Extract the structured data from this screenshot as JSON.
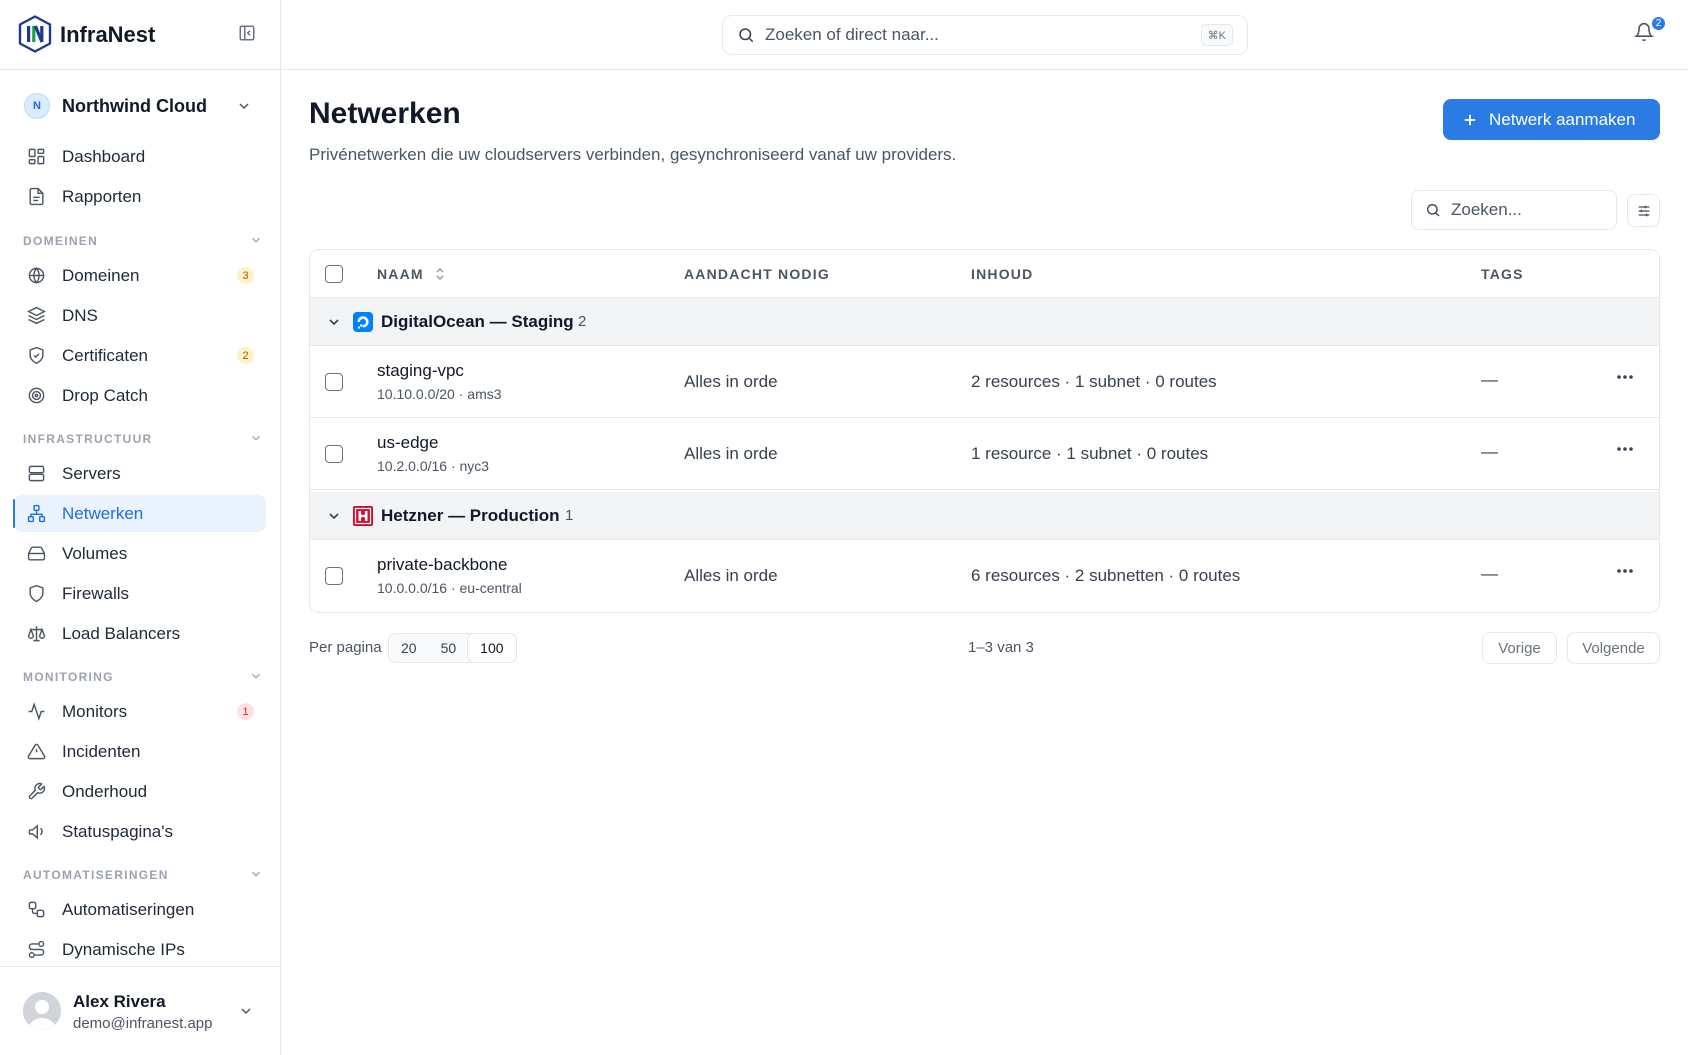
{
  "app": {
    "name": "InfraNest",
    "org": {
      "initial": "N",
      "name": "Northwind Cloud"
    }
  },
  "search": {
    "placeholder": "Zoeken of direct naar...",
    "shortcut": "⌘K"
  },
  "notifications": {
    "count": "2"
  },
  "sidebar": {
    "top_items": [
      {
        "label": "Dashboard",
        "icon": "grid-icon"
      },
      {
        "label": "Rapporten",
        "icon": "document-icon"
      }
    ],
    "sections": [
      {
        "label": "DOMEINEN",
        "items": [
          {
            "label": "Domeinen",
            "icon": "globe-icon",
            "badge": "3",
            "badge_color": "#b45309"
          },
          {
            "label": "DNS",
            "icon": "layers-icon"
          },
          {
            "label": "Certificaten",
            "icon": "shield-check-icon",
            "badge": "2",
            "badge_color": "#b45309"
          },
          {
            "label": "Drop Catch",
            "icon": "target-icon"
          }
        ]
      },
      {
        "label": "INFRASTRUCTUUR",
        "items": [
          {
            "label": "Servers",
            "icon": "server-icon"
          },
          {
            "label": "Netwerken",
            "icon": "network-icon",
            "active": true
          },
          {
            "label": "Volumes",
            "icon": "hard-drive-icon"
          },
          {
            "label": "Firewalls",
            "icon": "shield-icon"
          },
          {
            "label": "Load Balancers",
            "icon": "scale-icon"
          }
        ]
      },
      {
        "label": "MONITORING",
        "items": [
          {
            "label": "Monitors",
            "icon": "activity-icon",
            "badge": "1",
            "badge_color": "#dc2626"
          },
          {
            "label": "Incidenten",
            "icon": "alert-triangle-icon"
          },
          {
            "label": "Onderhoud",
            "icon": "wrench-icon"
          },
          {
            "label": "Statuspagina's",
            "icon": "megaphone-icon"
          }
        ]
      },
      {
        "label": "AUTOMATISERINGEN",
        "items": [
          {
            "label": "Automatiseringen",
            "icon": "workflow-icon"
          },
          {
            "label": "Dynamische IPs",
            "icon": "route-icon"
          }
        ]
      }
    ]
  },
  "user": {
    "name": "Alex Rivera",
    "email": "demo@infranest.app"
  },
  "page": {
    "title": "Netwerken",
    "subtitle": "Privénetwerken die uw cloudservers verbinden, gesynchroniseerd vanaf uw providers.",
    "create_button": "Netwerk aanmaken",
    "table_search_placeholder": "Zoeken..."
  },
  "table": {
    "columns": [
      "NAAM",
      "AANDACHT NODIG",
      "INHOUD",
      "TAGS"
    ],
    "groups": [
      {
        "name": "DigitalOcean — Staging",
        "count": "2",
        "provider_color": "#0080ff",
        "rows": [
          {
            "name": "staging-vpc",
            "sub": "10.10.0.0/20 · ams3",
            "status": "Alles in orde",
            "content": "2 resources · 1 subnet · 0 routes",
            "tags": "—"
          },
          {
            "name": "us-edge",
            "sub": "10.2.0.0/16 · nyc3",
            "status": "Alles in orde",
            "content": "1 resource · 1 subnet · 0 routes",
            "tags": "—"
          }
        ]
      },
      {
        "name": "Hetzner — Production",
        "count": "1",
        "provider_color": "#d50c2d",
        "rows": [
          {
            "name": "private-backbone",
            "sub": "10.0.0.0/16 · eu-central",
            "status": "Alles in orde",
            "content": "6 resources · 2 subnetten · 0 routes",
            "tags": "—"
          }
        ]
      }
    ]
  },
  "pagination": {
    "per_page_label": "Per pagina",
    "options": [
      "20",
      "50",
      "100"
    ],
    "selected": "100",
    "range": "1–3 van 3",
    "prev": "Vorige",
    "next": "Volgende"
  }
}
